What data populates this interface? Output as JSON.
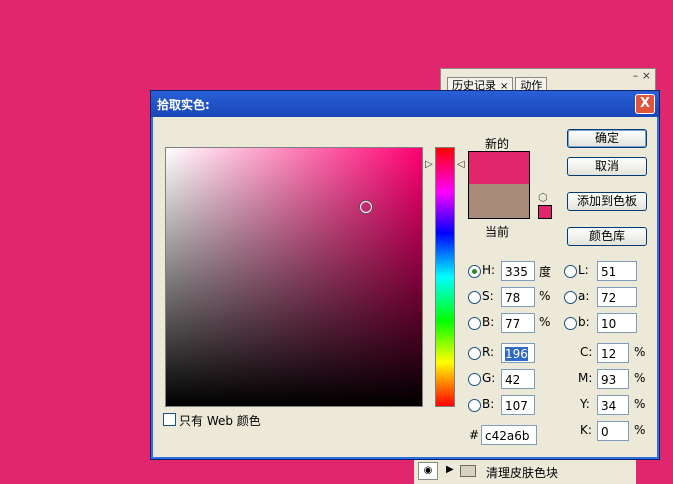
{
  "background_panel": {
    "tabs": [
      {
        "label": "历史记录",
        "close": "×"
      },
      {
        "label": "动作"
      }
    ],
    "controls": "– ×"
  },
  "layers_panel": {
    "layer_name": "清理皮肤色块"
  },
  "dialog": {
    "title": "拾取实色:",
    "close_glyph": "X",
    "new_label": "新的",
    "current_label": "当前",
    "new_color": "#e0266c",
    "current_color": "#a98b79",
    "hue_color": "#ff0072",
    "buttons": {
      "ok": "确定",
      "cancel": "取消",
      "add_swatch": "添加到色板",
      "libraries": "颜色库"
    },
    "hsb": [
      {
        "label": "H:",
        "value": "335",
        "unit": "度",
        "selected": true
      },
      {
        "label": "S:",
        "value": "78",
        "unit": "%"
      },
      {
        "label": "B:",
        "value": "77",
        "unit": "%"
      }
    ],
    "rgb": [
      {
        "label": "R:",
        "value": "196"
      },
      {
        "label": "G:",
        "value": "42"
      },
      {
        "label": "B:",
        "value": "107"
      }
    ],
    "lab": [
      {
        "label": "L:",
        "value": "51"
      },
      {
        "label": "a:",
        "value": "72"
      },
      {
        "label": "b:",
        "value": "10"
      }
    ],
    "cmyk": [
      {
        "label": "C:",
        "value": "12",
        "unit": "%"
      },
      {
        "label": "M:",
        "value": "93",
        "unit": "%"
      },
      {
        "label": "Y:",
        "value": "34",
        "unit": "%"
      },
      {
        "label": "K:",
        "value": "0",
        "unit": "%"
      }
    ],
    "hex_label": "#",
    "hex": "c42a6b",
    "web_only_label": "只有 Web 颜色"
  }
}
